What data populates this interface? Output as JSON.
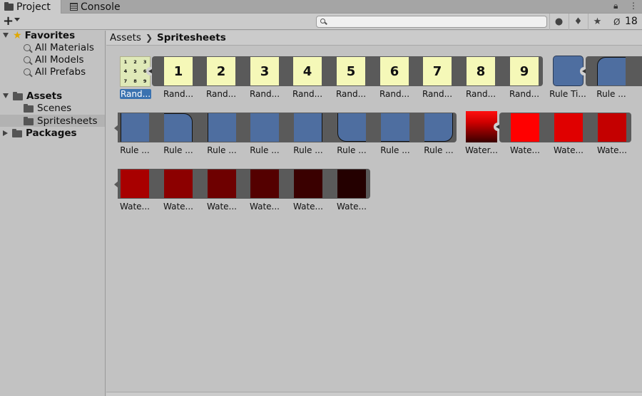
{
  "tabs": [
    {
      "label": "Project",
      "icon": "folder-icon",
      "active": true
    },
    {
      "label": "Console",
      "icon": "console-icon",
      "active": false
    }
  ],
  "toolbar": {
    "add_label": "+",
    "search_placeholder": "",
    "hidden_count": "18"
  },
  "sidebar": {
    "favorites": {
      "label": "Favorites",
      "items": [
        "All Materials",
        "All Models",
        "All Prefabs"
      ]
    },
    "assets": {
      "label": "Assets",
      "items": [
        "Scenes",
        "Spritesheets"
      ]
    },
    "packages": {
      "label": "Packages"
    }
  },
  "breadcrumb": {
    "root": "Assets",
    "current": "Spritesheets"
  },
  "grid": {
    "row1": {
      "random_tile_grid": [
        "1",
        "2",
        "3",
        "4",
        "5",
        "6",
        "7",
        "8",
        "9"
      ],
      "labels": [
        "Rand...",
        "Rand...",
        "Rand...",
        "Rand...",
        "Rand...",
        "Rand...",
        "Rand...",
        "Rand...",
        "Rand...",
        "Rand...",
        "Rule Ti...",
        "Rule ..."
      ],
      "numbers": [
        "1",
        "2",
        "3",
        "4",
        "5",
        "6",
        "7",
        "8",
        "9"
      ]
    },
    "row2": {
      "labels": [
        "Rule ...",
        "Rule ...",
        "Rule ...",
        "Rule ...",
        "Rule ...",
        "Rule ...",
        "Rule ...",
        "Rule ...",
        "Water...",
        "Wate...",
        "Wate...",
        "Wate..."
      ]
    },
    "row3": {
      "labels": [
        "Wate...",
        "Wate...",
        "Wate...",
        "Wate...",
        "Wate...",
        "Wate..."
      ]
    }
  },
  "colors": {
    "tile_blue": "#4e6ea0",
    "tile_yellow": "#f5f8b8",
    "selection": "#3a72b0",
    "water": [
      "#ff0000",
      "#e00000",
      "#c40000",
      "#a80000",
      "#8c0000",
      "#6e0000",
      "#540000",
      "#3a0000",
      "#240000"
    ]
  }
}
